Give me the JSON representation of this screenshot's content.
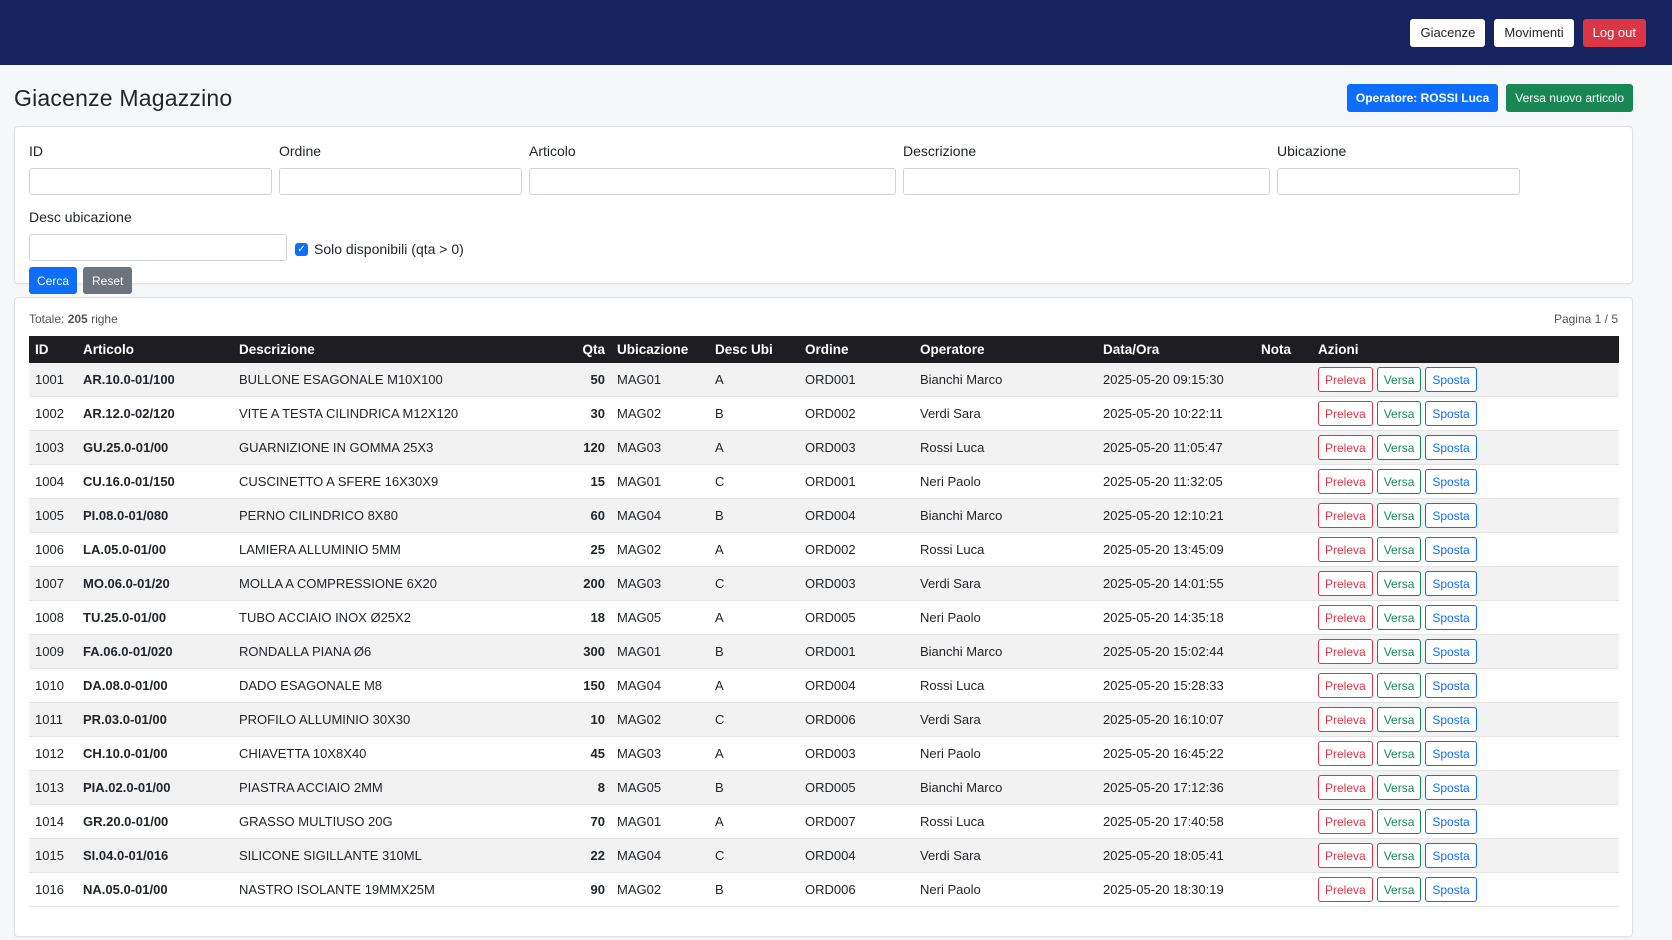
{
  "nav": {
    "giacenze": "Giacenze",
    "movimenti": "Movimenti",
    "logout": "Log out"
  },
  "header": {
    "title": "Giacenze Magazzino",
    "operator": "Operatore: ROSSI Luca",
    "new_item": "Versa nuovo articolo"
  },
  "filters": {
    "id_label": "ID",
    "ordine_label": "Ordine",
    "articolo_label": "Articolo",
    "descrizione_label": "Descrizione",
    "ubicazione_label": "Ubicazione",
    "desc_ubi_label": "Desc ubicazione",
    "only_available": "Solo disponibili (qta > 0)",
    "only_available_checked": true,
    "search": "Cerca",
    "reset": "Reset"
  },
  "results": {
    "total_prefix": "Totale:",
    "total": "205",
    "total_suffix": "righe",
    "page": "Pagina 1 / 5",
    "columns": [
      "ID",
      "Articolo",
      "Descrizione",
      "Qta",
      "Ubicazione",
      "Desc Ubi",
      "Ordine",
      "Operatore",
      "Data/Ora",
      "Nota",
      "Azioni"
    ],
    "actions": {
      "preleva": "Preleva",
      "versa": "Versa",
      "sposta": "Sposta"
    },
    "rows": [
      {
        "id": "1001",
        "articolo": "AR.10.0-01/100",
        "descrizione": "BULLONE ESAGONALE M10X100",
        "qta": "50",
        "ubicazione": "MAG01",
        "desc_ubi": "A",
        "ordine": "ORD001",
        "operatore": "Bianchi Marco",
        "data": "2025-05-20 09:15:30",
        "nota": ""
      },
      {
        "id": "1002",
        "articolo": "AR.12.0-02/120",
        "descrizione": "VITE A TESTA CILINDRICA M12X120",
        "qta": "30",
        "ubicazione": "MAG02",
        "desc_ubi": "B",
        "ordine": "ORD002",
        "operatore": "Verdi Sara",
        "data": "2025-05-20 10:22:11",
        "nota": ""
      },
      {
        "id": "1003",
        "articolo": "GU.25.0-01/00",
        "descrizione": "GUARNIZIONE IN GOMMA 25X3",
        "qta": "120",
        "ubicazione": "MAG03",
        "desc_ubi": "A",
        "ordine": "ORD003",
        "operatore": "Rossi Luca",
        "data": "2025-05-20 11:05:47",
        "nota": ""
      },
      {
        "id": "1004",
        "articolo": "CU.16.0-01/150",
        "descrizione": "CUSCINETTO A SFERE 16X30X9",
        "qta": "15",
        "ubicazione": "MAG01",
        "desc_ubi": "C",
        "ordine": "ORD001",
        "operatore": "Neri Paolo",
        "data": "2025-05-20 11:32:05",
        "nota": ""
      },
      {
        "id": "1005",
        "articolo": "PI.08.0-01/080",
        "descrizione": "PERNO CILINDRICO 8X80",
        "qta": "60",
        "ubicazione": "MAG04",
        "desc_ubi": "B",
        "ordine": "ORD004",
        "operatore": "Bianchi Marco",
        "data": "2025-05-20 12:10:21",
        "nota": ""
      },
      {
        "id": "1006",
        "articolo": "LA.05.0-01/00",
        "descrizione": "LAMIERA ALLUMINIO 5MM",
        "qta": "25",
        "ubicazione": "MAG02",
        "desc_ubi": "A",
        "ordine": "ORD002",
        "operatore": "Rossi Luca",
        "data": "2025-05-20 13:45:09",
        "nota": ""
      },
      {
        "id": "1007",
        "articolo": "MO.06.0-01/20",
        "descrizione": "MOLLA A COMPRESSIONE 6X20",
        "qta": "200",
        "ubicazione": "MAG03",
        "desc_ubi": "C",
        "ordine": "ORD003",
        "operatore": "Verdi Sara",
        "data": "2025-05-20 14:01:55",
        "nota": ""
      },
      {
        "id": "1008",
        "articolo": "TU.25.0-01/00",
        "descrizione": "TUBO ACCIAIO INOX Ø25X2",
        "qta": "18",
        "ubicazione": "MAG05",
        "desc_ubi": "A",
        "ordine": "ORD005",
        "operatore": "Neri Paolo",
        "data": "2025-05-20 14:35:18",
        "nota": ""
      },
      {
        "id": "1009",
        "articolo": "FA.06.0-01/020",
        "descrizione": "RONDALLA PIANA Ø6",
        "qta": "300",
        "ubicazione": "MAG01",
        "desc_ubi": "B",
        "ordine": "ORD001",
        "operatore": "Bianchi Marco",
        "data": "2025-05-20 15:02:44",
        "nota": ""
      },
      {
        "id": "1010",
        "articolo": "DA.08.0-01/00",
        "descrizione": "DADO ESAGONALE M8",
        "qta": "150",
        "ubicazione": "MAG04",
        "desc_ubi": "A",
        "ordine": "ORD004",
        "operatore": "Rossi Luca",
        "data": "2025-05-20 15:28:33",
        "nota": ""
      },
      {
        "id": "1011",
        "articolo": "PR.03.0-01/00",
        "descrizione": "PROFILO ALLUMINIO 30X30",
        "qta": "10",
        "ubicazione": "MAG02",
        "desc_ubi": "C",
        "ordine": "ORD006",
        "operatore": "Verdi Sara",
        "data": "2025-05-20 16:10:07",
        "nota": ""
      },
      {
        "id": "1012",
        "articolo": "CH.10.0-01/00",
        "descrizione": "CHIAVETTA 10X8X40",
        "qta": "45",
        "ubicazione": "MAG03",
        "desc_ubi": "A",
        "ordine": "ORD003",
        "operatore": "Neri Paolo",
        "data": "2025-05-20 16:45:22",
        "nota": ""
      },
      {
        "id": "1013",
        "articolo": "PIA.02.0-01/00",
        "descrizione": "PIASTRA ACCIAIO 2MM",
        "qta": "8",
        "ubicazione": "MAG05",
        "desc_ubi": "B",
        "ordine": "ORD005",
        "operatore": "Bianchi Marco",
        "data": "2025-05-20 17:12:36",
        "nota": ""
      },
      {
        "id": "1014",
        "articolo": "GR.20.0-01/00",
        "descrizione": "GRASSO MULTIUSO 20G",
        "qta": "70",
        "ubicazione": "MAG01",
        "desc_ubi": "A",
        "ordine": "ORD007",
        "operatore": "Rossi Luca",
        "data": "2025-05-20 17:40:58",
        "nota": ""
      },
      {
        "id": "1015",
        "articolo": "SI.04.0-01/016",
        "descrizione": "SILICONE SIGILLANTE 310ML",
        "qta": "22",
        "ubicazione": "MAG04",
        "desc_ubi": "C",
        "ordine": "ORD004",
        "operatore": "Verdi Sara",
        "data": "2025-05-20 18:05:41",
        "nota": ""
      },
      {
        "id": "1016",
        "articolo": "NA.05.0-01/00",
        "descrizione": "NASTRO ISOLANTE 19MMX25M",
        "qta": "90",
        "ubicazione": "MAG02",
        "desc_ubi": "B",
        "ordine": "ORD006",
        "operatore": "Neri Paolo",
        "data": "2025-05-20 18:30:19",
        "nota": ""
      }
    ]
  }
}
